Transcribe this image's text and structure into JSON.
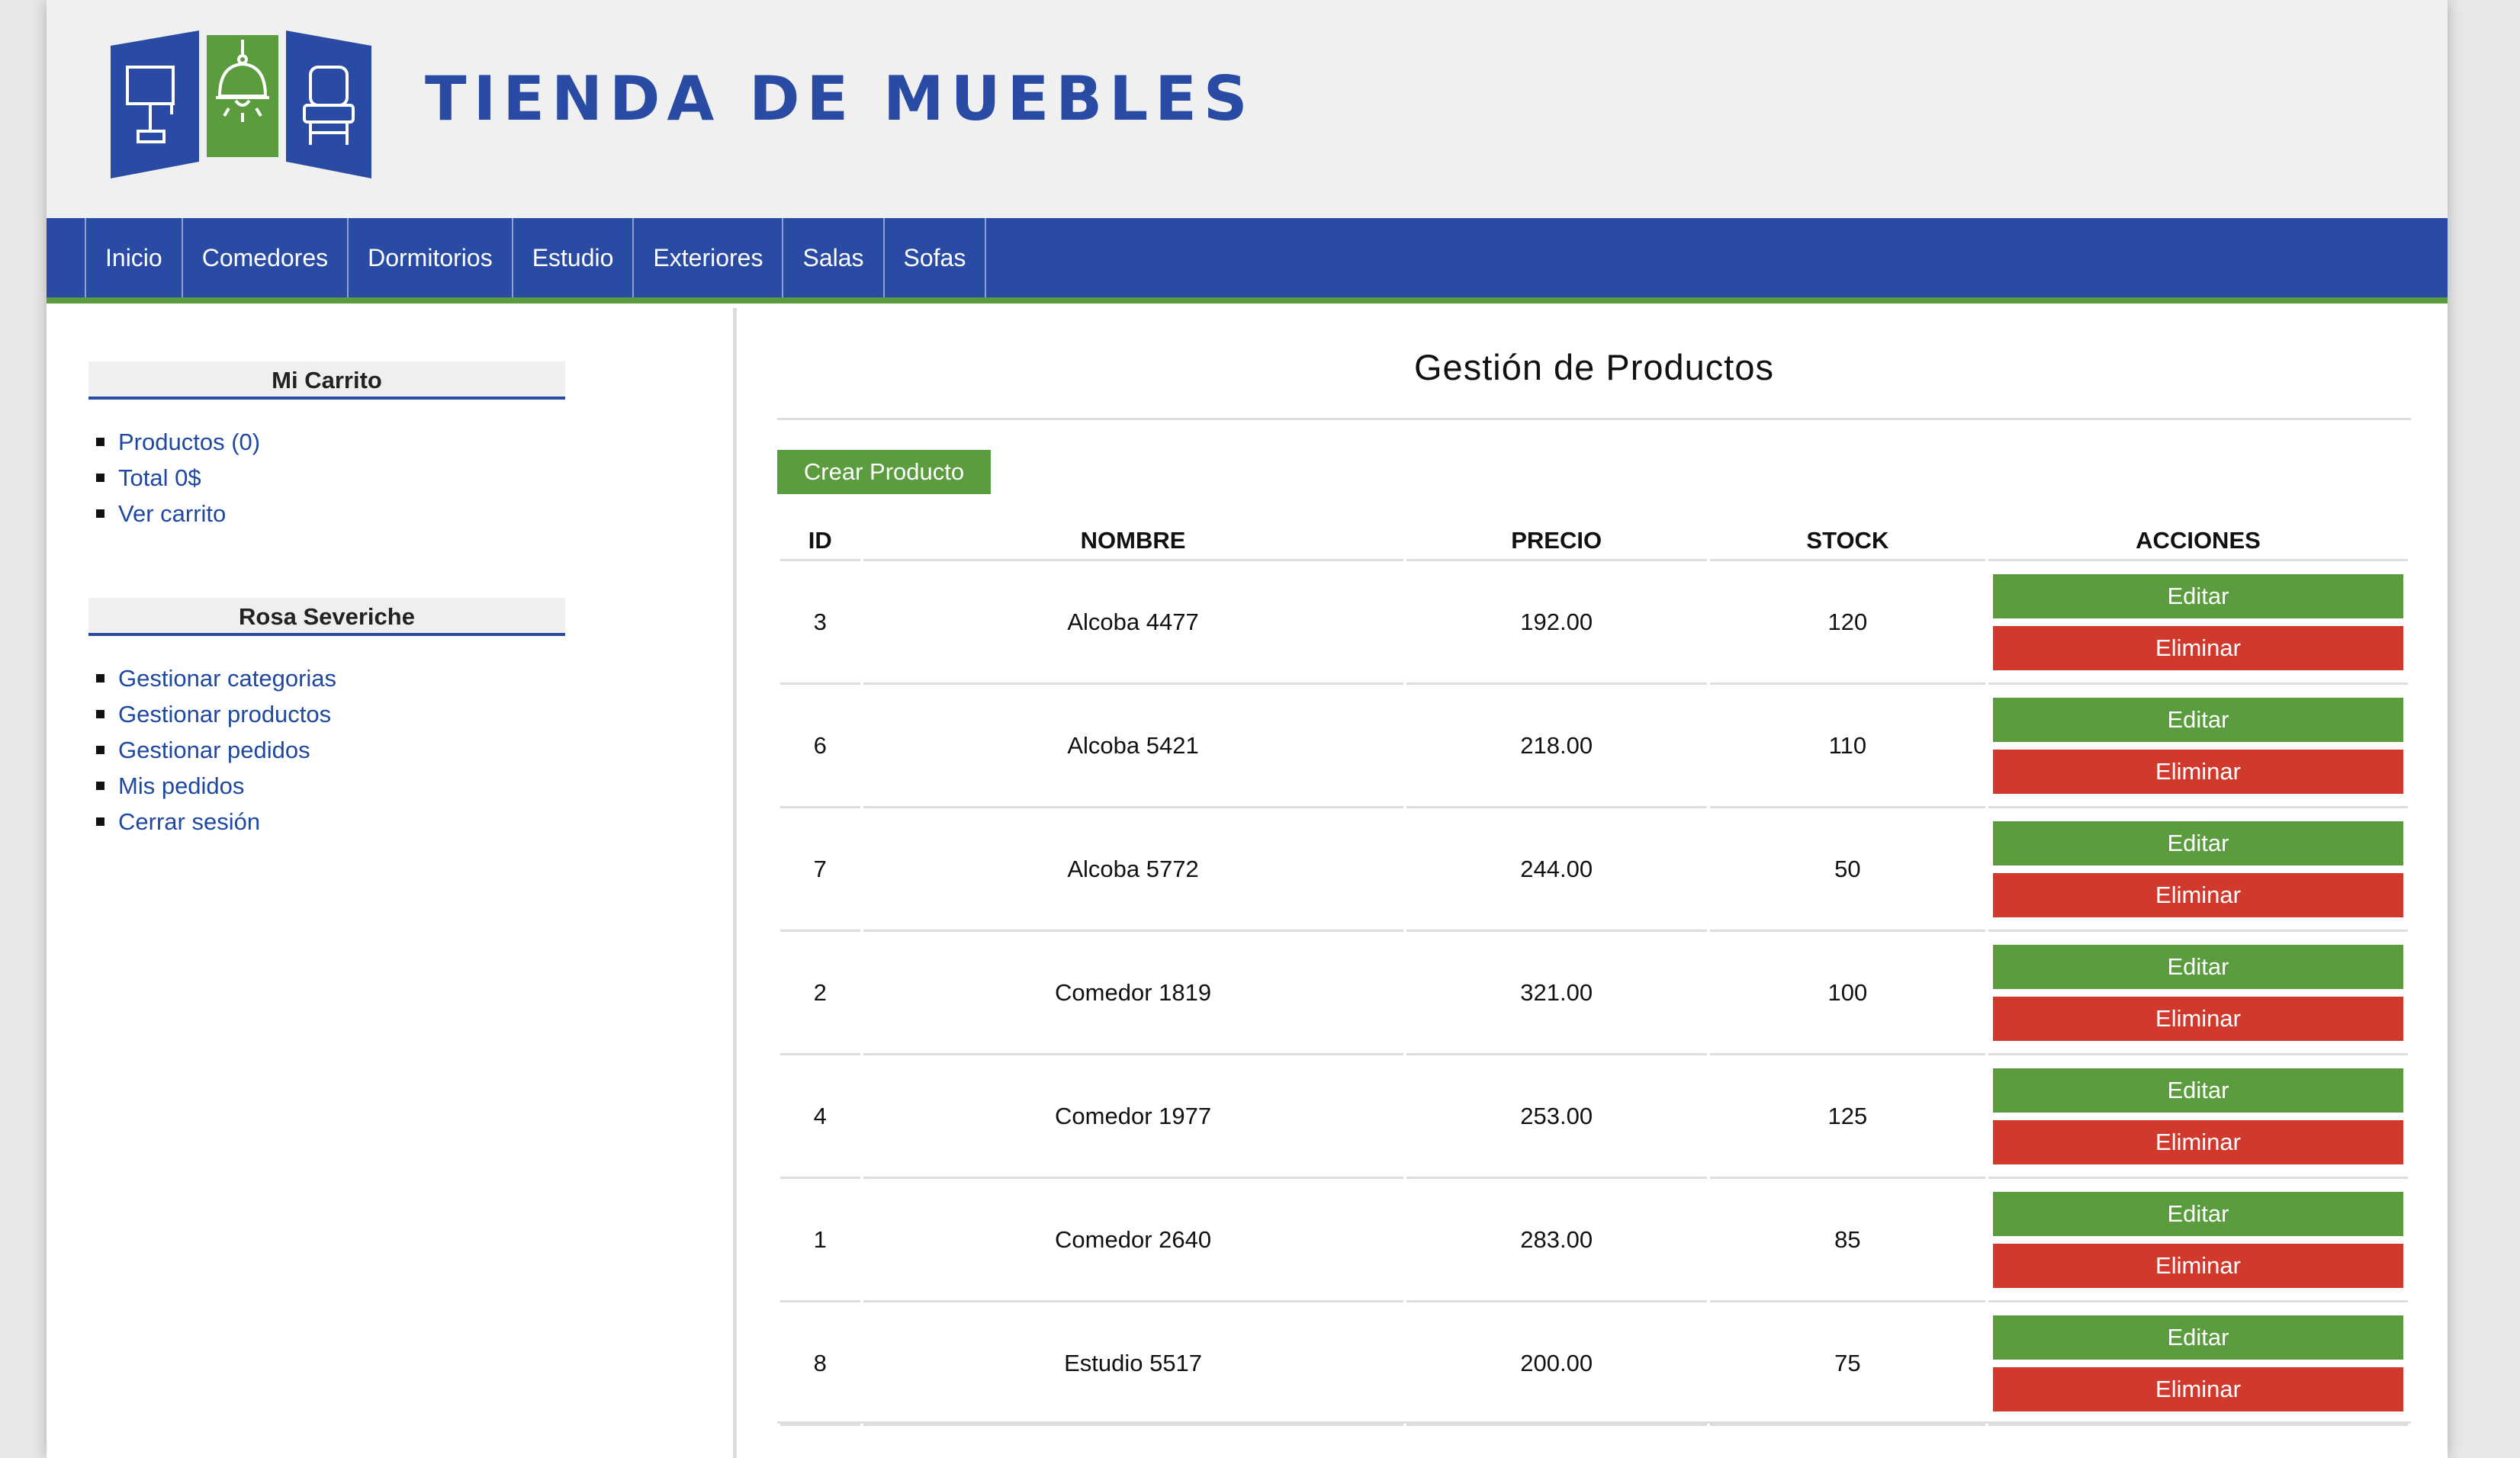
{
  "header": {
    "site_title": "TIENDA DE MUEBLES",
    "logo_icons": [
      "lamp-icon",
      "ceiling-light-icon",
      "chair-icon"
    ]
  },
  "colors": {
    "brand_blue": "#2a4ba3",
    "brand_green": "#5a9c3e",
    "danger_red": "#d0392b"
  },
  "nav": {
    "items": [
      {
        "label": "Inicio"
      },
      {
        "label": "Comedores"
      },
      {
        "label": "Dormitorios"
      },
      {
        "label": "Estudio"
      },
      {
        "label": "Exteriores"
      },
      {
        "label": "Salas"
      },
      {
        "label": "Sofas"
      }
    ]
  },
  "sidebar": {
    "cart": {
      "title": "Mi Carrito",
      "items": [
        {
          "label": "Productos (0)"
        },
        {
          "label": "Total 0$"
        },
        {
          "label": "Ver carrito"
        }
      ]
    },
    "user": {
      "title": "Rosa Severiche",
      "items": [
        {
          "label": "Gestionar categorias"
        },
        {
          "label": "Gestionar productos"
        },
        {
          "label": "Gestionar pedidos"
        },
        {
          "label": "Mis pedidos"
        },
        {
          "label": "Cerrar sesión"
        }
      ]
    }
  },
  "main": {
    "title": "Gestión de Productos",
    "create_label": "Crear Producto",
    "columns": [
      "ID",
      "NOMBRE",
      "PRECIO",
      "STOCK",
      "ACCIONES"
    ],
    "edit_label": "Editar",
    "delete_label": "Eliminar",
    "rows": [
      {
        "id": "3",
        "nombre": "Alcoba 4477",
        "precio": "192.00",
        "stock": "120"
      },
      {
        "id": "6",
        "nombre": "Alcoba 5421",
        "precio": "218.00",
        "stock": "110"
      },
      {
        "id": "7",
        "nombre": "Alcoba 5772",
        "precio": "244.00",
        "stock": "50"
      },
      {
        "id": "2",
        "nombre": "Comedor 1819",
        "precio": "321.00",
        "stock": "100"
      },
      {
        "id": "4",
        "nombre": "Comedor 1977",
        "precio": "253.00",
        "stock": "125"
      },
      {
        "id": "1",
        "nombre": "Comedor 2640",
        "precio": "283.00",
        "stock": "85"
      },
      {
        "id": "8",
        "nombre": "Estudio 5517",
        "precio": "200.00",
        "stock": "75"
      }
    ]
  }
}
